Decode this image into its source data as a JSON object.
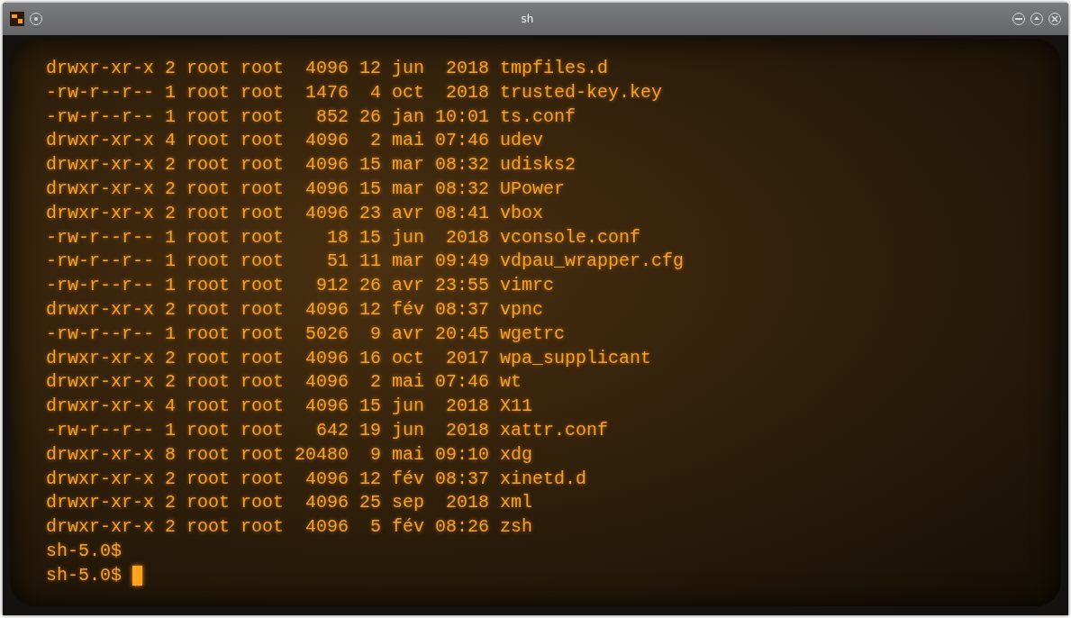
{
  "window": {
    "title": "sh"
  },
  "terminal": {
    "lines": [
      "drwxr-xr-x 2 root root  4096 12 jun  2018 tmpfiles.d",
      "-rw-r--r-- 1 root root  1476  4 oct  2018 trusted-key.key",
      "-rw-r--r-- 1 root root   852 26 jan 10:01 ts.conf",
      "drwxr-xr-x 4 root root  4096  2 mai 07:46 udev",
      "drwxr-xr-x 2 root root  4096 15 mar 08:32 udisks2",
      "drwxr-xr-x 2 root root  4096 15 mar 08:32 UPower",
      "drwxr-xr-x 2 root root  4096 23 avr 08:41 vbox",
      "-rw-r--r-- 1 root root    18 15 jun  2018 vconsole.conf",
      "-rw-r--r-- 1 root root    51 11 mar 09:49 vdpau_wrapper.cfg",
      "-rw-r--r-- 1 root root   912 26 avr 23:55 vimrc",
      "drwxr-xr-x 2 root root  4096 12 fév 08:37 vpnc",
      "-rw-r--r-- 1 root root  5026  9 avr 20:45 wgetrc",
      "drwxr-xr-x 2 root root  4096 16 oct  2017 wpa_supplicant",
      "drwxr-xr-x 2 root root  4096  2 mai 07:46 wt",
      "drwxr-xr-x 4 root root  4096 15 jun  2018 X11",
      "-rw-r--r-- 1 root root   642 19 jun  2018 xattr.conf",
      "drwxr-xr-x 8 root root 20480  9 mai 09:10 xdg",
      "drwxr-xr-x 2 root root  4096 12 fév 08:37 xinetd.d",
      "drwxr-xr-x 2 root root  4096 25 sep  2018 xml",
      "drwxr-xr-x 2 root root  4096  5 fév 08:26 zsh",
      "sh-5.0$"
    ],
    "prompt": "sh-5.0$"
  }
}
